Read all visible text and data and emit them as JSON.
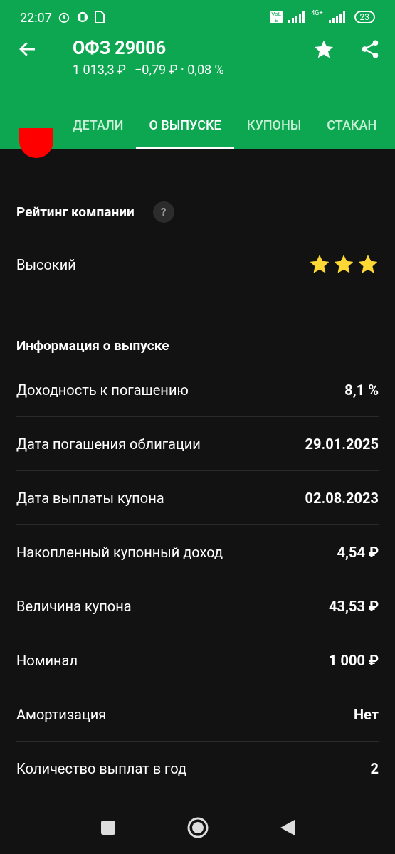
{
  "status_bar": {
    "time": "22:07",
    "volte": "VoLTE",
    "network": "4G+",
    "battery": "23"
  },
  "header": {
    "title": "ОФЗ 29006",
    "price": "1 013,3 ₽",
    "change": "−0,79 ₽ · 0,08 %"
  },
  "tabs": [
    {
      "label": "ДЕТАЛИ",
      "selected": false
    },
    {
      "label": "О ВЫПУСКЕ",
      "selected": true
    },
    {
      "label": "КУПОНЫ",
      "selected": false
    },
    {
      "label": "СТАКАН",
      "selected": false
    }
  ],
  "rating": {
    "title": "Рейтинг компании",
    "help": "?",
    "value": "Высокий",
    "stars": 3
  },
  "info": {
    "title": "Информация о выпуске",
    "rows": [
      {
        "label": "Доходность к погашению",
        "value": "8,1 %"
      },
      {
        "label": "Дата погашения облигации",
        "value": "29.01.2025"
      },
      {
        "label": "Дата выплаты купона",
        "value": "02.08.2023"
      },
      {
        "label": "Накопленный купонный доход",
        "value": "4,54 ₽"
      },
      {
        "label": "Величина купона",
        "value": "43,53 ₽"
      },
      {
        "label": "Номинал",
        "value": "1 000 ₽"
      },
      {
        "label": "Амортизация",
        "value": "Нет"
      },
      {
        "label": "Количество выплат в год",
        "value": "2"
      }
    ]
  }
}
